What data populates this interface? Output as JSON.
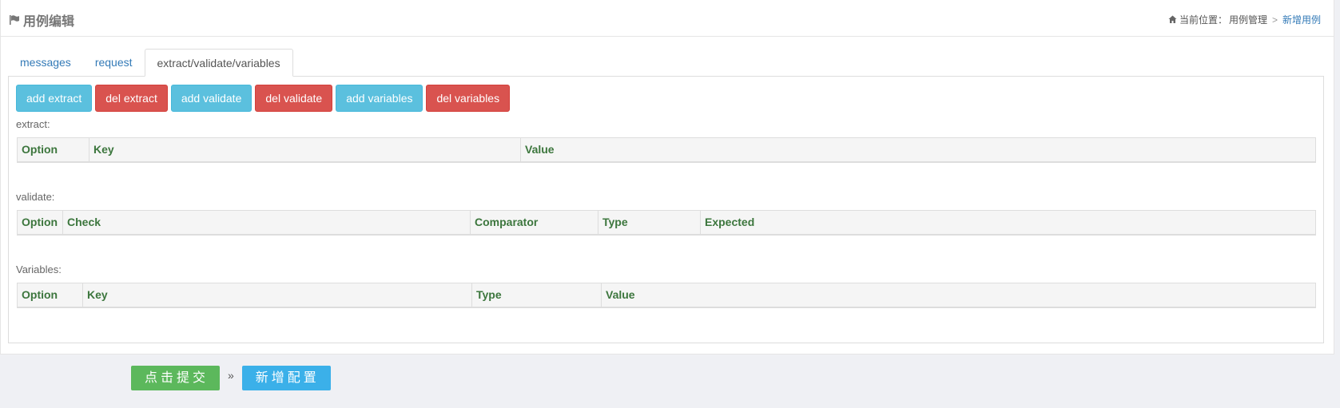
{
  "header": {
    "title": "用例编辑",
    "breadcrumb": {
      "prefix": "当前位置：",
      "parent": "用例管理",
      "separator": ">",
      "current": "新增用例"
    }
  },
  "tabs": [
    {
      "label": "messages",
      "active": false
    },
    {
      "label": "request",
      "active": false
    },
    {
      "label": "extract/validate/variables",
      "active": true
    }
  ],
  "toolbar": {
    "add_extract": "add extract",
    "del_extract": "del extract",
    "add_validate": "add validate",
    "del_validate": "del validate",
    "add_variables": "add variables",
    "del_variables": "del variables"
  },
  "extract": {
    "label": "extract:",
    "columns": [
      "Option",
      "Key",
      "Value"
    ]
  },
  "validate": {
    "label": "validate:",
    "columns": [
      "Option",
      "Check",
      "Comparator",
      "Type",
      "Expected"
    ]
  },
  "variables": {
    "label": "Variables:",
    "columns": [
      "Option",
      "Key",
      "Type",
      "Value"
    ]
  },
  "footer": {
    "submit_label": "点击提交",
    "raquo": "»",
    "add_config_label": "新增配置"
  },
  "colors": {
    "info": "#5bc0de",
    "danger": "#d9534f",
    "success": "#5cb85c",
    "header_text": "#3c763d",
    "link": "#337ab7"
  },
  "icons": [
    "flag-icon",
    "home-icon"
  ]
}
